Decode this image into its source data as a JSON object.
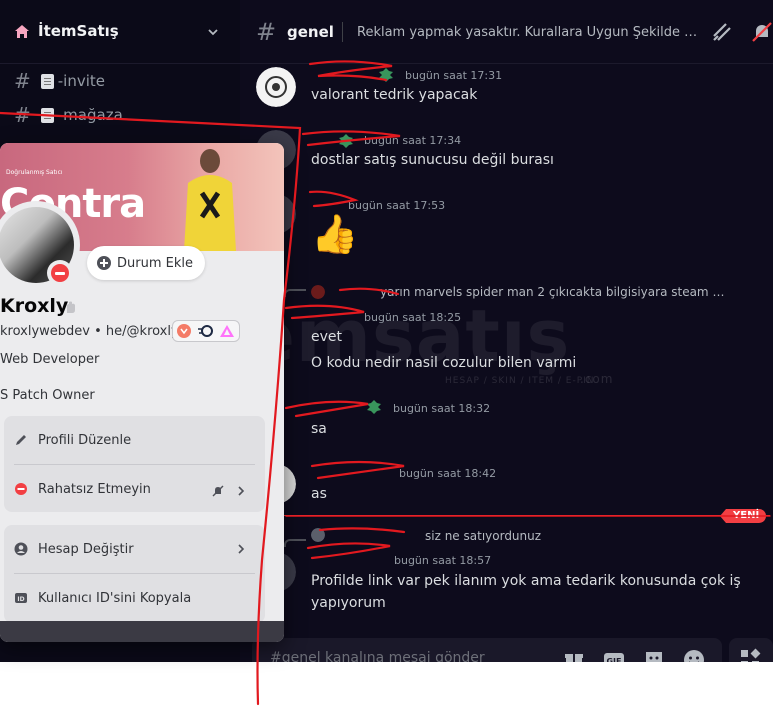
{
  "server": {
    "name": "İtemSatış"
  },
  "sidebar": {
    "channels": [
      {
        "label": "-invite"
      },
      {
        "label": "-mağaza"
      }
    ]
  },
  "header": {
    "channel": "genel",
    "topic": "Reklam yapmak yasaktır. Kurallara Uygun Şekilde Sohbet Edin"
  },
  "messages": [
    {
      "time": "bugün saat 17:31",
      "text": "valorant tedrik yapacak"
    },
    {
      "time": "bugün saat 17:34",
      "text": "dostlar satış sunucusu değil burası"
    },
    {
      "time": "bugün saat 17:53",
      "text": "👍"
    },
    {
      "reply": "yarın marvels spider man 2 çıkıcakta bilgisiyara steam hesap satışı",
      "time": "bugün saat 18:25",
      "lines": [
        "evet",
        "O kodu nedir nasil cozulur bilen varmi"
      ]
    },
    {
      "time": "bugün saat 18:32",
      "text": "sa"
    },
    {
      "time": "bugün saat 18:42",
      "text": "as"
    },
    {
      "reply": "siz ne satıyordunuz",
      "time": "bugün saat 18:57",
      "lines": [
        "Profilde link var pek ilanım yok ama tedarik konusunda çok iş",
        "yapıyorum"
      ]
    }
  ],
  "new_label": "YENİ",
  "watermark": {
    "text": "itemsatış",
    "sub": "HESAP / SKIN / ITEM / E-PIN",
    "domain": ".com"
  },
  "composer": {
    "placeholder": "#genel kanalına mesaj gönder"
  },
  "profile": {
    "banner_small": "Doğrulanmış Satıcı",
    "banner_big": "Contra",
    "status_button": "Durum Ekle",
    "name": "Kroxly",
    "username": "kroxlywebdev",
    "pronouns": "he/@kroxly",
    "dot": "•",
    "lines": [
      "Web Developer",
      "S Patch Owner"
    ],
    "actions": {
      "edit": "Profili Düzenle",
      "dnd": "Rahatsız Etmeyin",
      "switch": "Hesap Değiştir",
      "copy_id": "Kullanıcı ID'sini Kopyala"
    }
  },
  "colors": {
    "accent_red": "#f23f43",
    "bg": "#0d0b1c",
    "card": "#ececee"
  }
}
